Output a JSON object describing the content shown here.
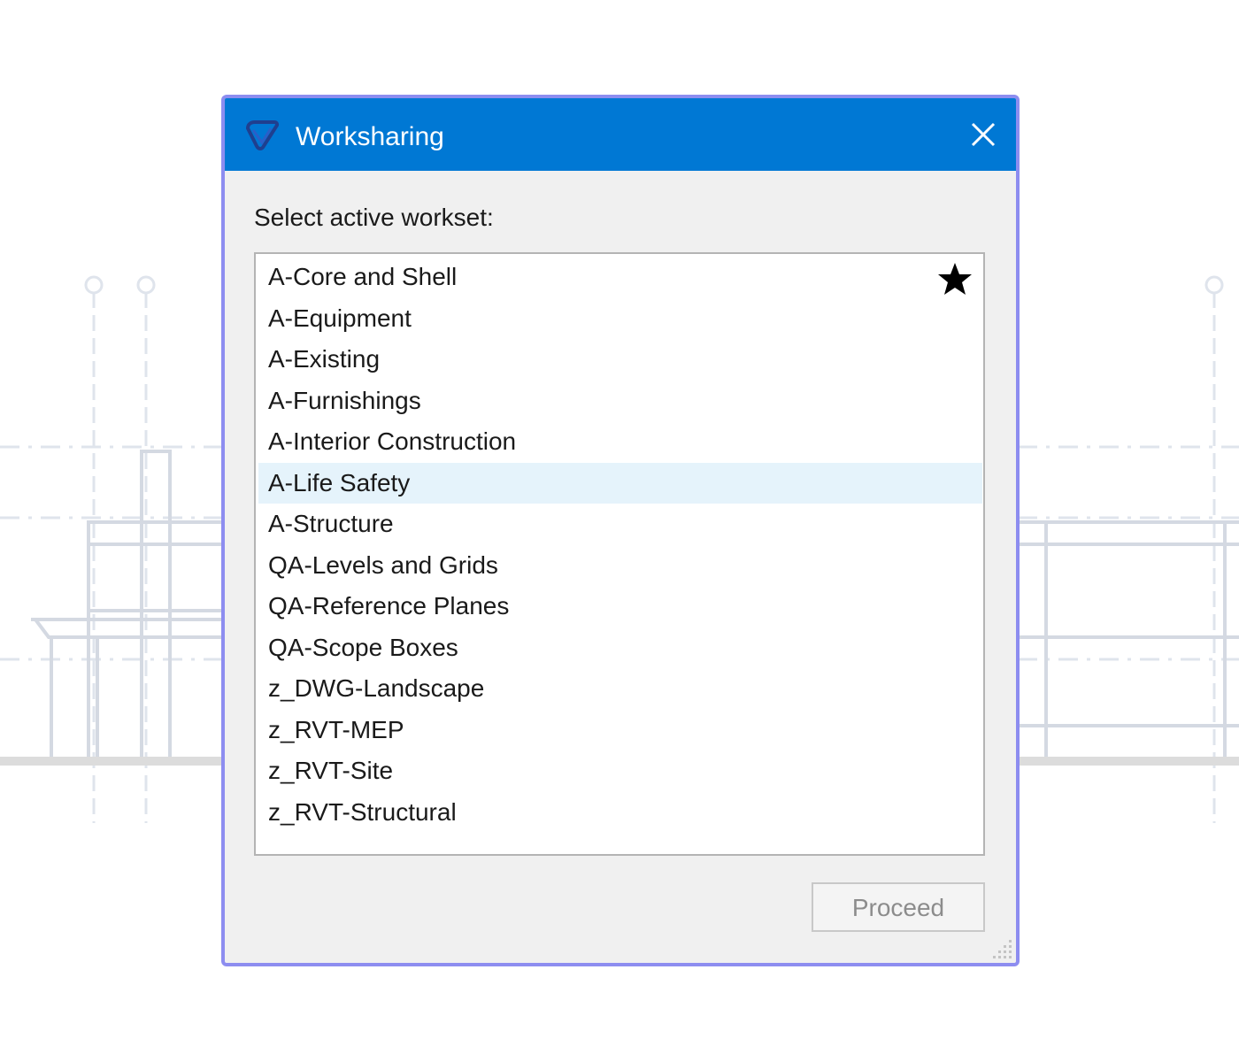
{
  "dialog": {
    "title": "Worksharing",
    "prompt": "Select active workset:",
    "proceed_label": "Proceed",
    "close_icon": "close-icon",
    "logo_icon": "app-logo-icon",
    "favorite_icon": "star-icon"
  },
  "worksets": {
    "items": [
      "A-Core and Shell",
      "A-Equipment",
      "A-Existing",
      "A-Furnishings",
      "A-Interior Construction",
      "A-Life Safety",
      "A-Structure",
      "QA-Levels and Grids",
      "QA-Reference Planes",
      "QA-Scope Boxes",
      "z_DWG-Landscape",
      "z_RVT-MEP",
      "z_RVT-Site",
      "z_RVT-Structural"
    ],
    "selected_index": 5,
    "favorite_index": 0
  },
  "colors": {
    "titlebar": "#0078d4",
    "frame_border": "#8d8df0",
    "selection": "#e5f3fb",
    "dialog_background": "#f0f0f0"
  }
}
